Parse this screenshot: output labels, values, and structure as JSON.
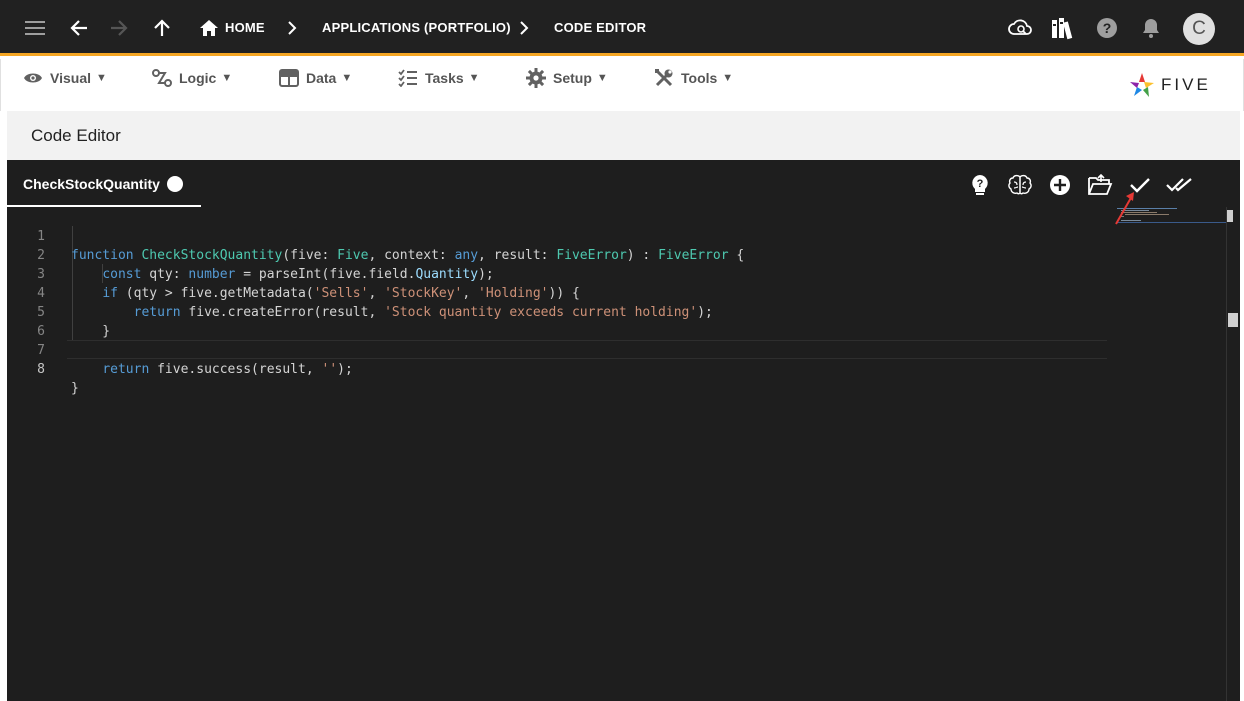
{
  "header": {
    "breadcrumbs": [
      "HOME",
      "APPLICATIONS (PORTFOLIO)",
      "CODE EDITOR"
    ],
    "avatar_initial": "C",
    "icons": [
      "menu-icon",
      "back-arrow-icon",
      "forward-arrow-icon",
      "up-arrow-icon",
      "home-icon",
      "cloud-search-icon",
      "library-icon",
      "help-icon",
      "bell-icon"
    ],
    "accent_color": "#f5a623"
  },
  "menu": {
    "items": [
      {
        "label": "Visual",
        "icon": "eye-icon"
      },
      {
        "label": "Logic",
        "icon": "logic-flow-icon"
      },
      {
        "label": "Data",
        "icon": "table-icon"
      },
      {
        "label": "Tasks",
        "icon": "checklist-icon"
      },
      {
        "label": "Setup",
        "icon": "gear-icon"
      },
      {
        "label": "Tools",
        "icon": "wrench-icon"
      }
    ],
    "caret": "▼",
    "logo_text": "FIVE"
  },
  "page": {
    "title": "Code Editor"
  },
  "editor": {
    "tab_label": "CheckStockQuantity",
    "toolbar_icons": [
      "help-bulb-icon",
      "brain-icon",
      "add-circle-icon",
      "open-folder-icon",
      "check-icon",
      "double-check-icon"
    ],
    "active_line": 8,
    "line_numbers": [
      "1",
      "2",
      "3",
      "4",
      "5",
      "6",
      "7",
      "8"
    ],
    "lines": [
      "function CheckStockQuantity(five: Five, context: any, result: FiveError) : FiveError {",
      "    const qty: number = parseInt(five.field.Quantity);",
      "    if (qty > five.getMetadata('Sells', 'StockKey', 'Holding')) {",
      "        return five.createError(result, 'Stock quantity exceeds current holding');",
      "    }",
      "",
      "    return five.success(result, '');",
      "}"
    ]
  }
}
